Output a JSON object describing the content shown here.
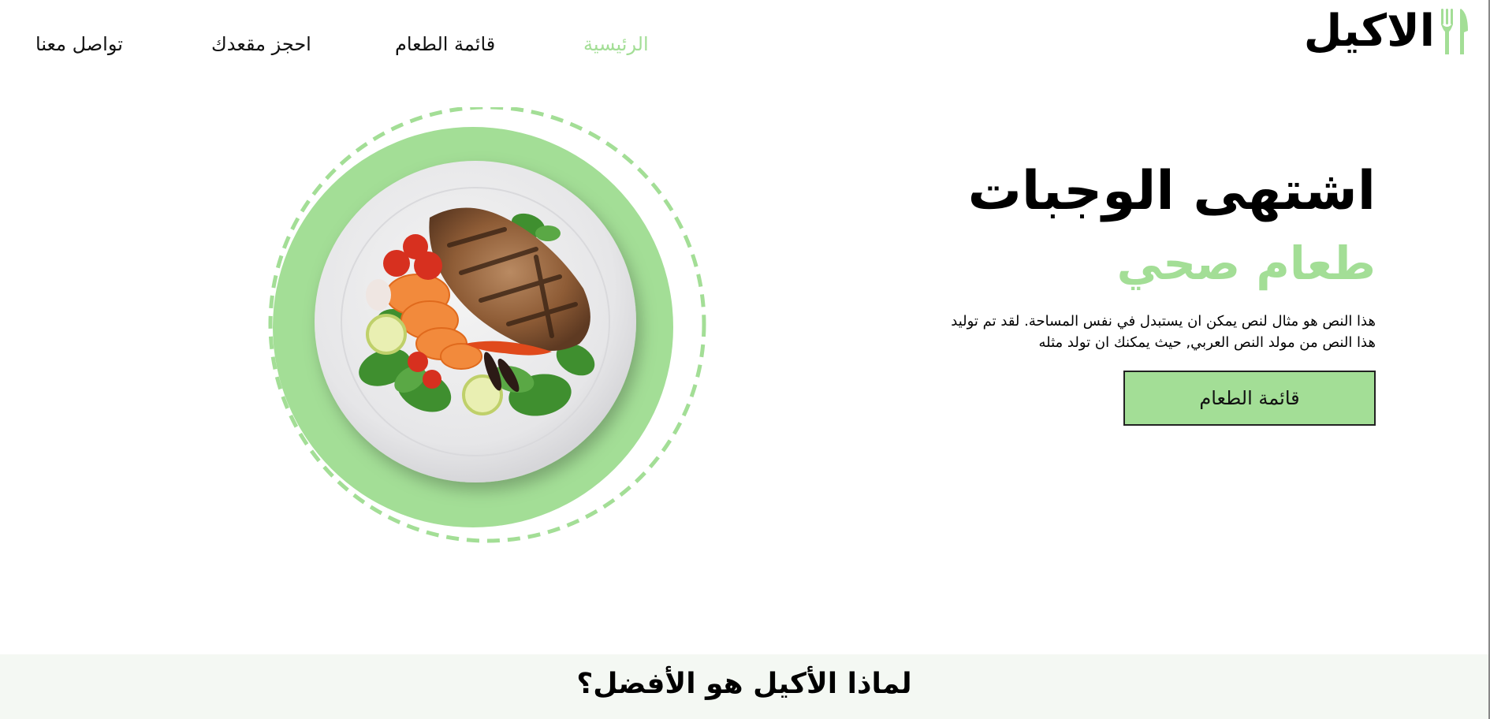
{
  "brand": {
    "name": "الاكيل",
    "icon": "fork-knife-icon",
    "accent_color": "#a3de96"
  },
  "nav": {
    "items": [
      {
        "label": "الرئيسية",
        "active": true
      },
      {
        "label": "قائمة الطعام",
        "active": false
      },
      {
        "label": "احجز مقعدك",
        "active": false
      },
      {
        "label": "تواصل معنا",
        "active": false
      }
    ]
  },
  "hero": {
    "title": "اشتهى الوجبات",
    "subtitle": "طعام صحي",
    "description": "هذا النص هو مثال لنص يمكن ان يستبدل في نفس المساحة. لقد تم توليد هذا النص من مولد النص العربي, حيث يمكنك ان تولد مثله",
    "button_label": "قائمة الطعام",
    "image": "grilled-chicken-plate-image"
  },
  "why": {
    "title": "لماذا الأكيل هو الأفضل؟"
  }
}
